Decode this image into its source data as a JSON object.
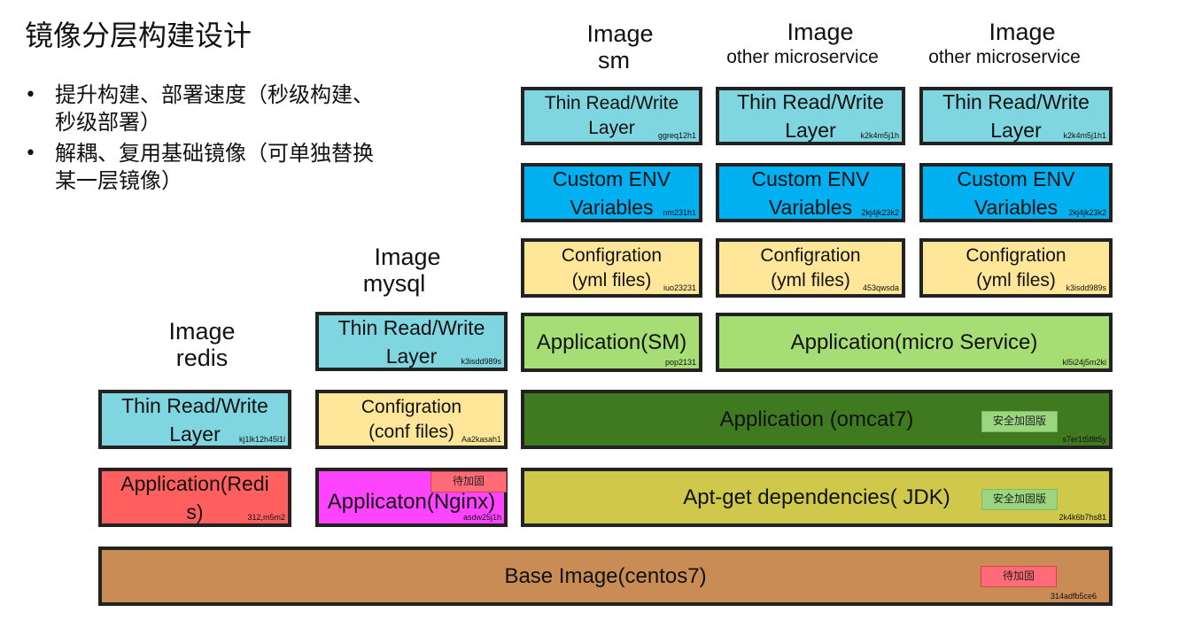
{
  "title": "镜像分层构建设计",
  "bullets": [
    "提升构建、部署速度（秒级构建、秒级部署）",
    "解耦、复用基础镜像（可单独替换某一层镜像）"
  ],
  "labels": {
    "sm": {
      "line1": "Image",
      "line2": "sm"
    },
    "other1": {
      "line1": "Image",
      "line2": "other microservice"
    },
    "other2": {
      "line1": "Image",
      "line2": "other microservice"
    },
    "mysql": {
      "line1": "Image",
      "line2": "mysql"
    },
    "redis": {
      "line1": "Image",
      "line2": "redis"
    }
  },
  "layers": {
    "sm_thin": {
      "line1": "Thin Read/Write",
      "line2": "Layer",
      "code": "ggreq12h1"
    },
    "other1_thin": {
      "line1": "Thin Read/Write",
      "line2": "Layer",
      "code": "k2k4m5j1h"
    },
    "other2_thin": {
      "line1": "Thin Read/Write",
      "line2": "Layer",
      "code": "k2k4m5j1h1"
    },
    "sm_env": {
      "line1": "Custom ENV",
      "line2": "Variables",
      "code": "nm231h1"
    },
    "other1_env": {
      "line1": "Custom ENV",
      "line2": "Variables",
      "code": "2kj4jk23k2"
    },
    "other2_env": {
      "line1": "Custom ENV",
      "line2": "Variables",
      "code": "2kj4jk23k2"
    },
    "sm_conf": {
      "line1": "Configration",
      "line2": "(yml files)",
      "code": "iuo23231"
    },
    "other1_conf": {
      "line1": "Configration",
      "line2": "(yml files)",
      "code": "453qwsda"
    },
    "other2_conf": {
      "line1": "Configration",
      "line2": "(yml files)",
      "code": "k3isdd989s"
    },
    "sm_app": {
      "line1": "Application(SM)",
      "code": "pop2131"
    },
    "micro_app": {
      "line1": "Application(micro Service)",
      "code": "kl5i24j5m2ki"
    },
    "mysql_thin": {
      "line1": "Thin Read/Write",
      "line2": "Layer",
      "code": "k3isdd989s"
    },
    "mysql_conf": {
      "line1": "Configration",
      "line2": "(conf files)",
      "code": "Aa2kasah1"
    },
    "nginx_app": {
      "line1": "Applicaton(Nginx)",
      "code": "asdw25j1h",
      "tag": "待加固"
    },
    "tomcat": {
      "line1": "Application (omcat7)",
      "code": "s7er1t5f8t5y",
      "tag": "安全加固版"
    },
    "jdk": {
      "line1": "Apt-get dependencies( JDK)",
      "code": "2k4k6b7hs81",
      "tag": "安全加固版"
    },
    "redis_thin": {
      "line1": "Thin Read/Write",
      "line2": "Layer",
      "code": "kj1lk12h45l1l"
    },
    "redis_app": {
      "line1": "Application(Redi",
      "line2": "s)",
      "code": "312,m5m2"
    },
    "base": {
      "line1": "Base Image(centos7)",
      "code": "314adfb5ce6",
      "tag": "待加固"
    }
  },
  "colors": {
    "thin": "#7fd6e0",
    "env": "#00b0f0",
    "conf": "#ffe699",
    "app_light": "#a6dd74",
    "tomcat": "#3f7a20",
    "jdk": "#cfc84a",
    "redis": "#ff5f5f",
    "nginx": "#ff44ff",
    "base": "#c88c54"
  }
}
